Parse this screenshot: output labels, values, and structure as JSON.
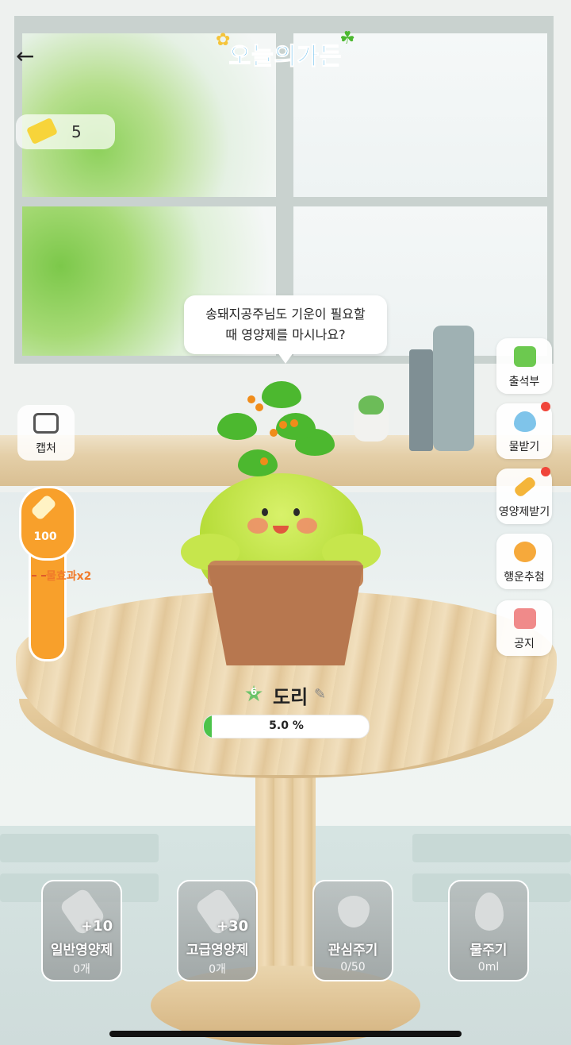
{
  "header": {
    "back_icon": "arrow-left-icon",
    "logo_text": "오늘의가든"
  },
  "ticket": {
    "icon": "ticket-icon",
    "count": "5"
  },
  "speech_bubble": {
    "line1": "송돼지공주님도 기운이 필요할",
    "line2": "때 영양제를 마시나요?"
  },
  "capture": {
    "label": "캡처",
    "icon": "camera-icon"
  },
  "water_gauge": {
    "value": "100",
    "effect_label": "물효과x2",
    "icon": "bottle-icon"
  },
  "side_menu": [
    {
      "label": "출석부",
      "icon": "calendar-icon",
      "color": "#6cc94f",
      "badge": false
    },
    {
      "label": "물받기",
      "icon": "water-drop-icon",
      "color": "#7fc4ea",
      "badge": true
    },
    {
      "label": "영양제받기",
      "icon": "nutrient-icon",
      "color": "#f4b53a",
      "badge": true
    },
    {
      "label": "행운추첨",
      "icon": "clover-icon",
      "color": "#f6a93b",
      "badge": false
    },
    {
      "label": "공지",
      "icon": "megaphone-icon",
      "color": "#f08a8a",
      "badge": false
    }
  ],
  "plant": {
    "level": "6",
    "name": "도리",
    "progress_text": "5.0 %",
    "progress": 0.05
  },
  "actions": [
    {
      "name": "일반영양제",
      "plus": "+10",
      "count": "0개",
      "icon": "nutrient-bottle-icon"
    },
    {
      "name": "고급영양제",
      "plus": "+30",
      "count": "0개",
      "icon": "premium-nutrient-icon"
    },
    {
      "name": "관심주기",
      "plus": "",
      "count": "0/50",
      "icon": "heart-icon"
    },
    {
      "name": "물주기",
      "plus": "",
      "count": "0ml",
      "icon": "water-drop-icon"
    }
  ],
  "colors": {
    "accent_orange": "#f8a02b",
    "progress_green": "#4cc34a",
    "logo_blue": "#33a7e6",
    "badge_red": "#f0453a"
  }
}
